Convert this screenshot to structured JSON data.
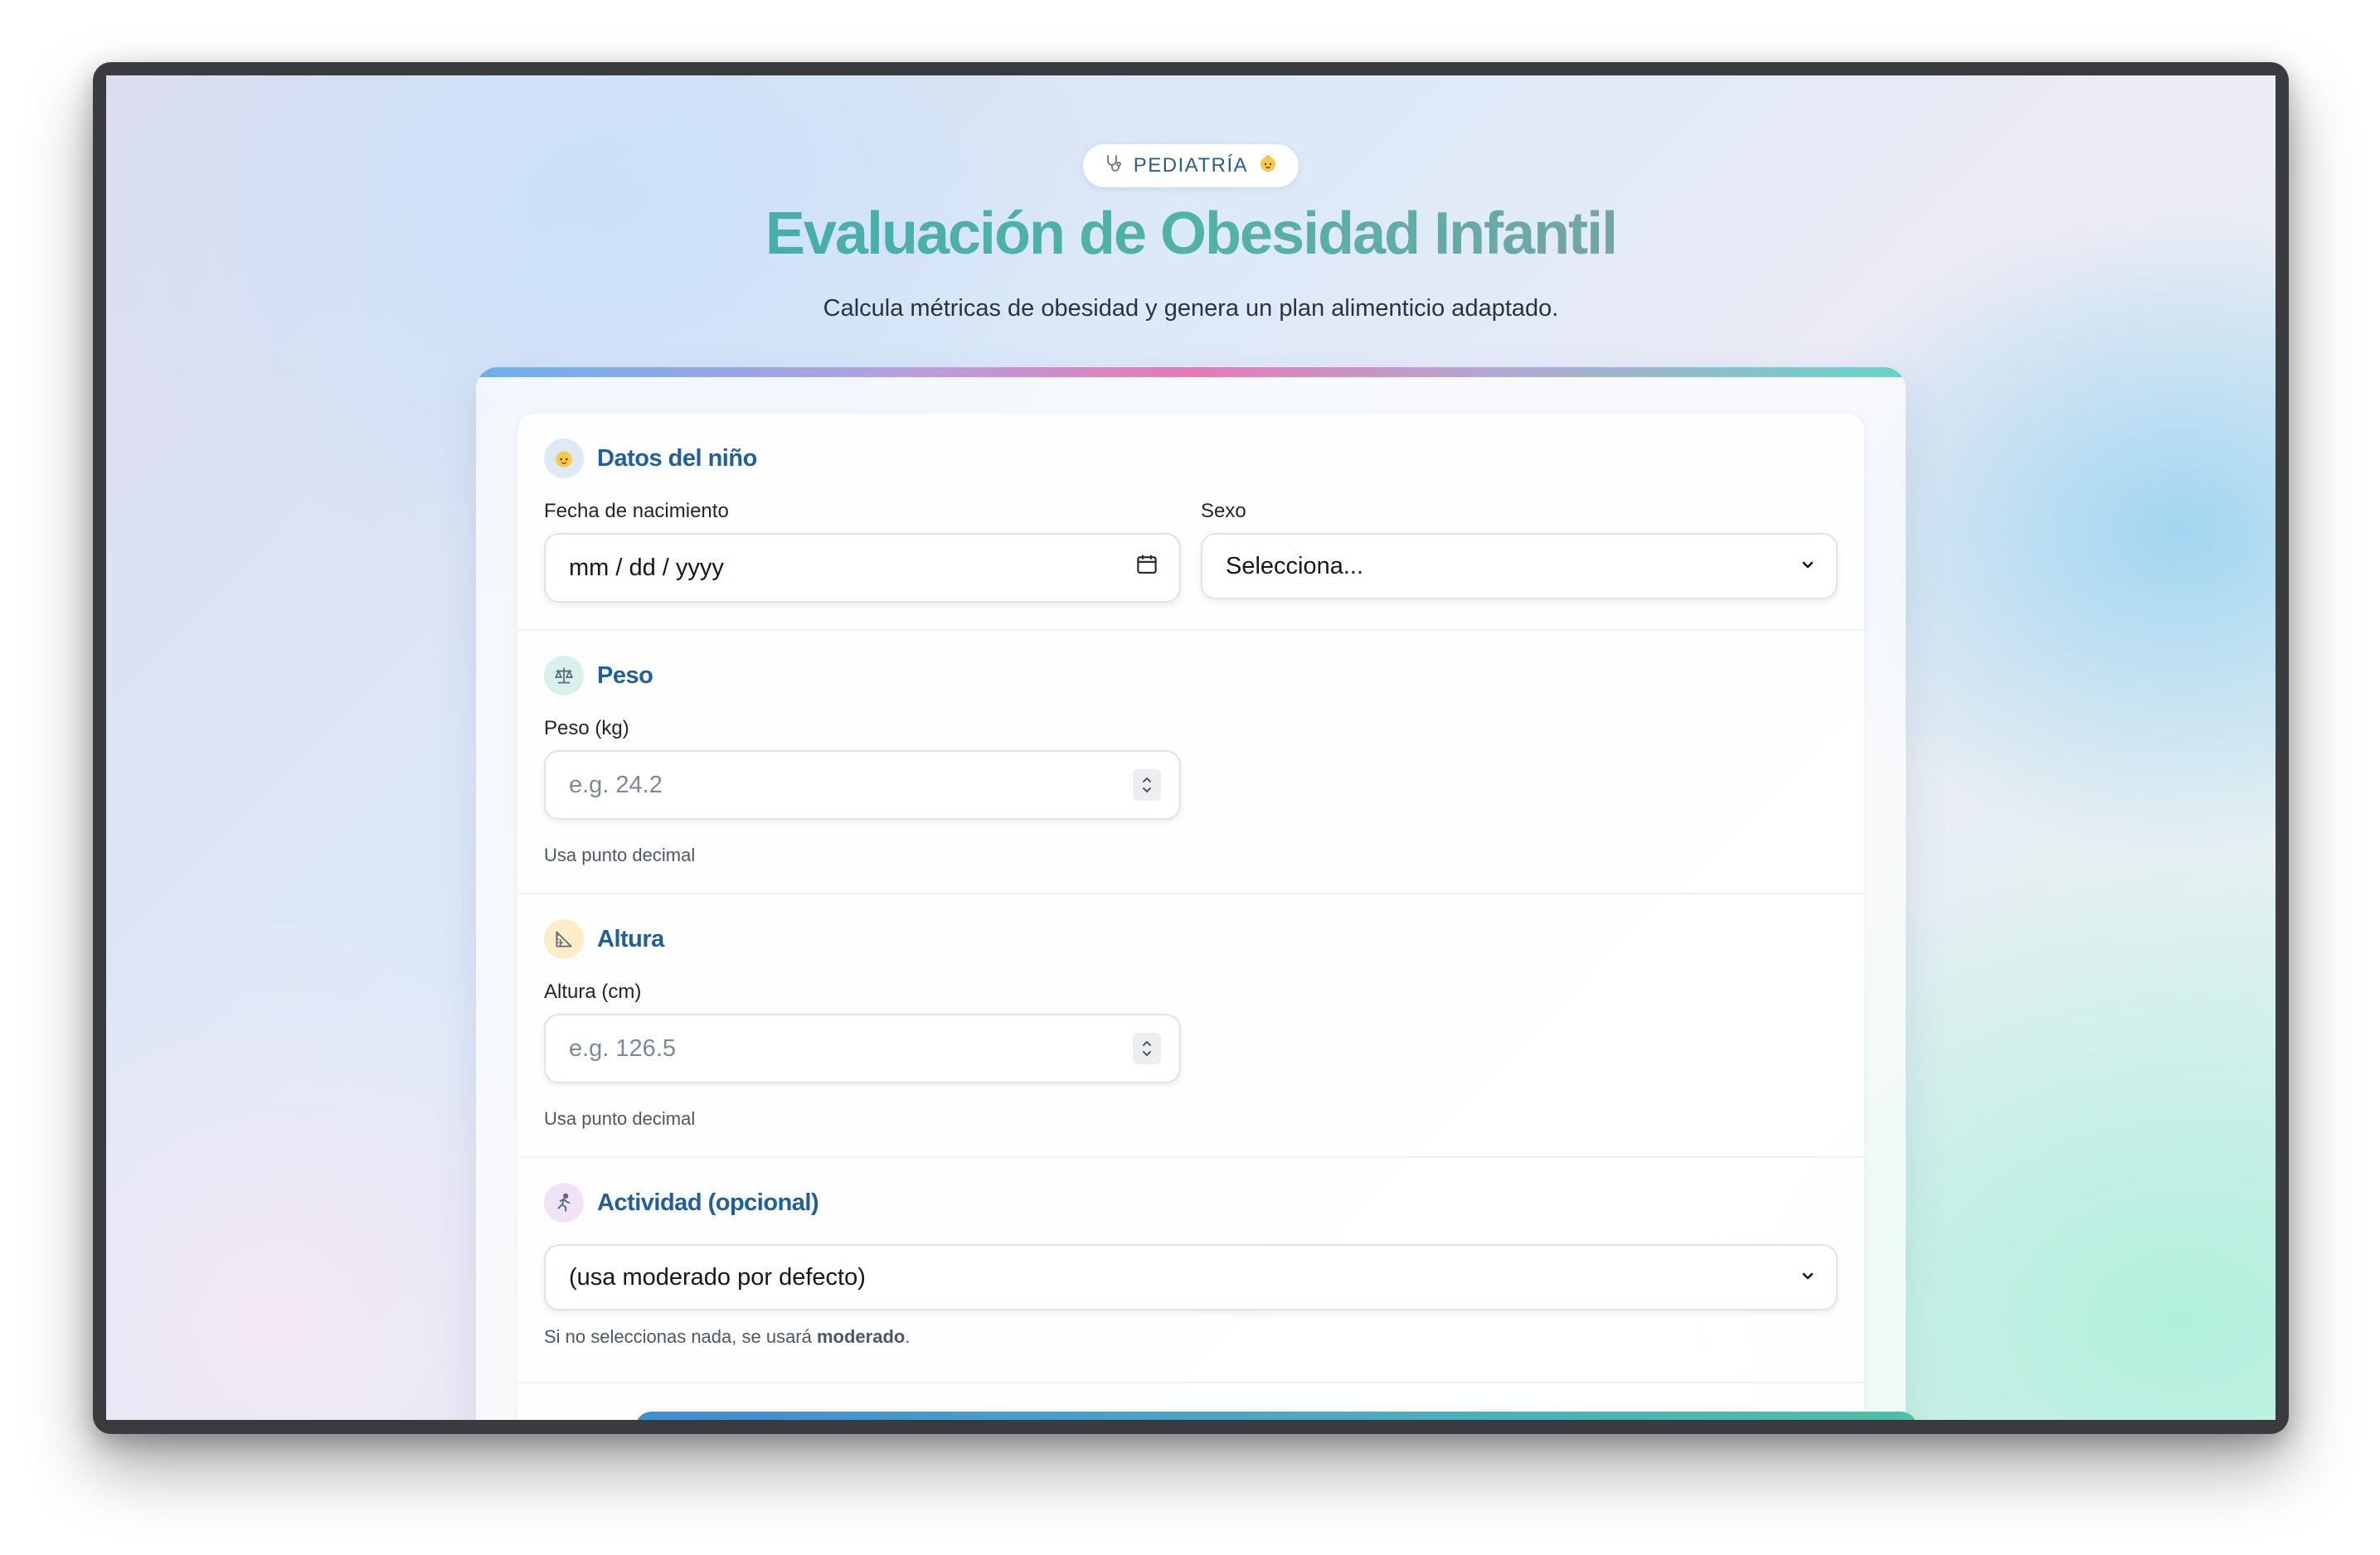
{
  "header": {
    "badge_icon_left": "stethoscope-icon",
    "badge_label": "PEDIATRÍA",
    "badge_icon_right": "baby-face-icon",
    "title": "Evaluación de Obesidad Infantil",
    "subtitle": "Calcula métricas de obesidad y genera un plan alimenticio adaptado."
  },
  "sections": {
    "child": {
      "icon": "baby-face-icon",
      "title": "Datos del niño",
      "birthdate_label": "Fecha de nacimiento",
      "birthdate_placeholder": "mm / dd / yyyy",
      "sex_label": "Sexo",
      "sex_value": "Selecciona..."
    },
    "weight": {
      "icon": "scale-icon",
      "title": "Peso",
      "label": "Peso (kg)",
      "placeholder": "e.g. 24.2",
      "hint": "Usa punto decimal"
    },
    "height": {
      "icon": "ruler-icon",
      "title": "Altura",
      "label": "Altura (cm)",
      "placeholder": "e.g. 126.5",
      "hint": "Usa punto decimal"
    },
    "activity": {
      "icon": "runner-icon",
      "title": "Actividad (opcional)",
      "value": "(usa moderado por defecto)",
      "hint_prefix": "Si no seleccionas nada, se usará ",
      "hint_bold": "moderado",
      "hint_suffix": "."
    }
  },
  "colors": {
    "accent_blue": "#1f5f9e",
    "title_gradient_start": "#3aa6b5",
    "title_gradient_end": "#9aa2ab"
  }
}
